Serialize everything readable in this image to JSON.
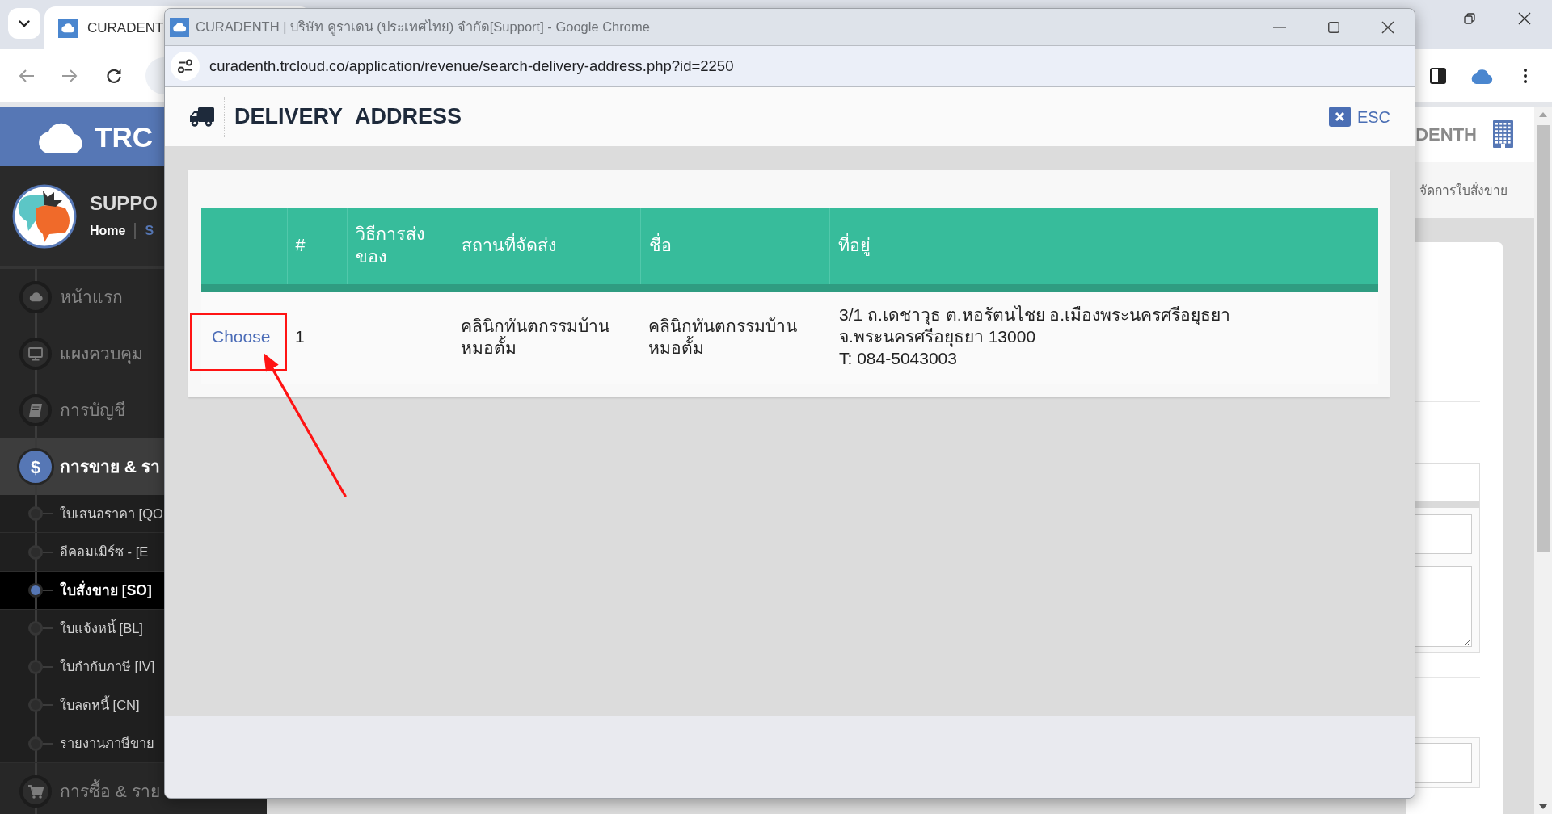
{
  "main_window": {
    "tab": {
      "title": "CURADENT"
    },
    "sidebar": {
      "logo": "TRC",
      "profile": {
        "name": "SUPPO",
        "links": [
          {
            "label": "Home",
            "selected": true
          },
          {
            "label": "S",
            "selected": false
          }
        ]
      },
      "menu": [
        {
          "label": "หน้าแรก",
          "selected": false
        },
        {
          "label": "แผงควบคุม",
          "selected": false
        },
        {
          "label": "การบัญชี",
          "selected": false
        },
        {
          "label": "การขาย & รา",
          "icon_char": "$",
          "selected": true,
          "children": [
            {
              "label": "ใบเสนอราคา [QO",
              "selected": false
            },
            {
              "label": "อีคอมเมิร์ซ - [E",
              "selected": false
            },
            {
              "label": "ใบสั่งขาย [SO]",
              "selected": true
            },
            {
              "label": "ใบแจ้งหนี้ [BL]",
              "selected": false
            },
            {
              "label": "ใบกำกับภาษี [IV]",
              "selected": false
            },
            {
              "label": "ใบลดหนี้ [CN]",
              "selected": false
            },
            {
              "label": "รายงานภาษีขาย",
              "selected": false
            }
          ]
        },
        {
          "label": "การซื้อ & ราย",
          "selected": false
        }
      ]
    },
    "header": {
      "company": "DENTH"
    },
    "breadcrumb": "จัดการใบสั่งขาย"
  },
  "popup": {
    "title": "CURADENTH | บริษัท คูราเดน (ประเทศไทย) จำกัด[Support] - Google Chrome",
    "url": "curadenth.trcloud.co/application/revenue/search-delivery-address.php?id=2250",
    "heading": "DELIVERY ADDRESS",
    "close_label": "ESC",
    "table": {
      "columns": [
        "#",
        "วิธีการส่งของ",
        "สถานที่จัดส่ง",
        "ชื่อ",
        "ที่อยู่"
      ],
      "rows": [
        {
          "action": "Choose",
          "number": "1",
          "location": "คลินิกทันตกรรมบ้านหมอตั้ม",
          "name": "คลินิกทันตกรรมบ้านหมอตั้ม",
          "address_lines": [
            "3/1 ถ.เดชาวุธ ต.หอรัตนไชย อ.เมืองพระนครศรีอยุธยา",
            "จ.พระนครศรีอยุธยา 13000",
            "T: 084-5043003"
          ],
          "annotated": true
        }
      ]
    }
  }
}
